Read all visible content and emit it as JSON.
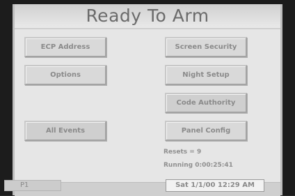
{
  "header": {
    "title": "Ready To Arm"
  },
  "buttons": {
    "ecp_address": "ECP Address",
    "screen_security": "Screen Security",
    "options": "Options",
    "night_setup": "Night Setup",
    "code_authority": "Code Authority",
    "all_events": "All Events",
    "panel_config": "Panel Config"
  },
  "status": {
    "resets": "Resets = 9",
    "running": "Running 0:00:25:41"
  },
  "footer": {
    "page": "P1",
    "datetime": "Sat 1/1/00 12:29 AM"
  }
}
